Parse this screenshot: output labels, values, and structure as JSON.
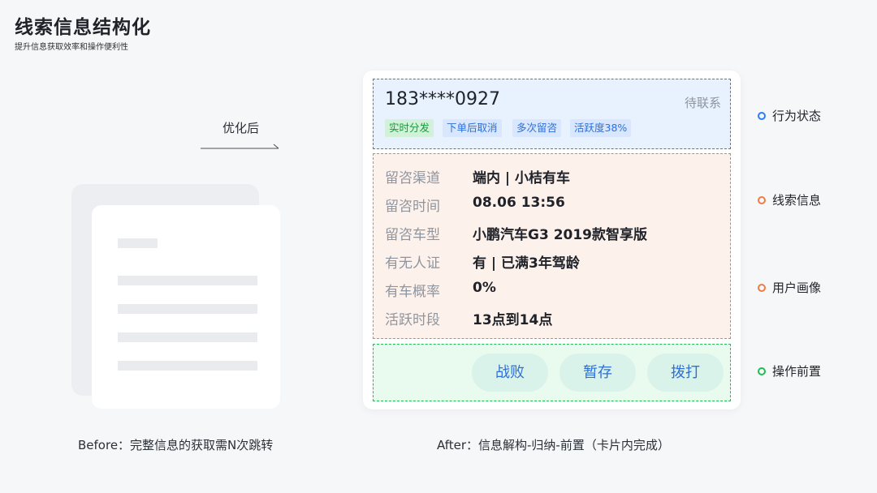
{
  "header": {
    "title": "线索信息结构化",
    "subtitle": "提升信息获取效率和操作便利性"
  },
  "transition": {
    "label": "优化后"
  },
  "captions": {
    "before": "Before：完整信息的获取需N次跳转",
    "after": "After：信息解构-归纳-前置（卡片内完成）"
  },
  "card": {
    "phone": "183****0927",
    "status": "待联系",
    "tags": [
      "实时分发",
      "下单后取消",
      "多次留咨",
      "活跃度38%"
    ],
    "rows": [
      {
        "label": "留咨渠道",
        "value": "端内 | 小桔有车"
      },
      {
        "label": "留咨时间",
        "value": "08.06 13:56"
      },
      {
        "label": "留咨车型",
        "value": "小鹏汽车G3 2019款智享版"
      },
      {
        "label": "有无人证",
        "value": "有 | 已满3年驾龄"
      },
      {
        "label": "有车概率",
        "value": "0%"
      },
      {
        "label": "活跃时段",
        "value": "13点到14点"
      }
    ],
    "buttons": [
      "战败",
      "暂存",
      "拨打"
    ]
  },
  "legend": [
    {
      "label": "行为状态",
      "color": "#2c7ef8"
    },
    {
      "label": "线索信息",
      "color": "#f07b45"
    },
    {
      "label": "用户画像",
      "color": "#f07b45"
    },
    {
      "label": "操作前置",
      "color": "#1fbd52"
    }
  ]
}
